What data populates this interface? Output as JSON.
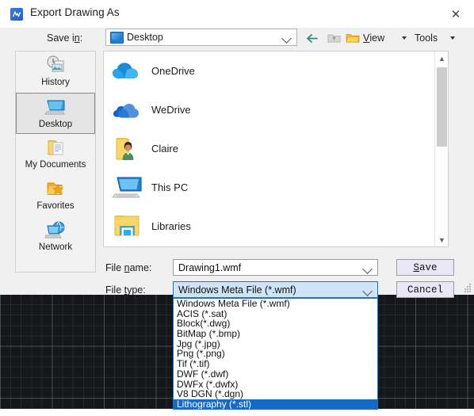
{
  "window": {
    "title": "Export Drawing As",
    "icon": "app-logo-icon",
    "close_label": "✕"
  },
  "toolbar": {
    "save_in_label": "Save in:",
    "save_in_value": "Desktop",
    "back_icon": "back-arrow-icon",
    "up_icon": "up-folder-icon",
    "new_folder_icon": "new-folder-icon",
    "view_label": "View",
    "tools_label": "Tools"
  },
  "places": {
    "items": [
      {
        "label": "History",
        "icon": "history-clock-icon",
        "selected": false
      },
      {
        "label": "Desktop",
        "icon": "desktop-monitor-icon",
        "selected": true
      },
      {
        "label": "My Documents",
        "icon": "my-documents-folder-icon",
        "selected": false
      },
      {
        "label": "Favorites",
        "icon": "favorites-star-folder-icon",
        "selected": false
      },
      {
        "label": "Network",
        "icon": "network-globe-icon",
        "selected": false
      }
    ]
  },
  "file_list": {
    "items": [
      {
        "label": "OneDrive",
        "icon": "onedrive-cloud-icon"
      },
      {
        "label": "WeDrive",
        "icon": "wedrive-cloud-icon"
      },
      {
        "label": "Claire",
        "icon": "user-folder-icon"
      },
      {
        "label": "This PC",
        "icon": "this-pc-monitor-icon"
      },
      {
        "label": "Libraries",
        "icon": "libraries-folder-icon"
      }
    ]
  },
  "fields": {
    "file_name_label": "File name:",
    "file_name_value": "Drawing1.wmf",
    "file_type_label": "File type:",
    "file_type_value": "Windows Meta File (*.wmf)"
  },
  "buttons": {
    "save_label": "Save",
    "cancel_label": "Cancel"
  },
  "dropdown": {
    "options": [
      "Windows Meta File (*.wmf)",
      "ACIS (*.sat)",
      "Block(*.dwg)",
      "BitMap (*.bmp)",
      "Jpg (*.jpg)",
      "Png (*.png)",
      "Tif (*.tif)",
      "DWF (*.dwf)",
      "DWFx (*.dwfx)",
      "V8 DGN (*.dgn)",
      "Lithography (*.stl)"
    ],
    "selected_index": 10
  },
  "colors": {
    "accent_blue": "#1569c7",
    "combo_highlight": "#cfe4f7",
    "canvas_background": "#15171a",
    "dialog_background": "#f0f0f0",
    "button_face": "#e9e7f5"
  }
}
